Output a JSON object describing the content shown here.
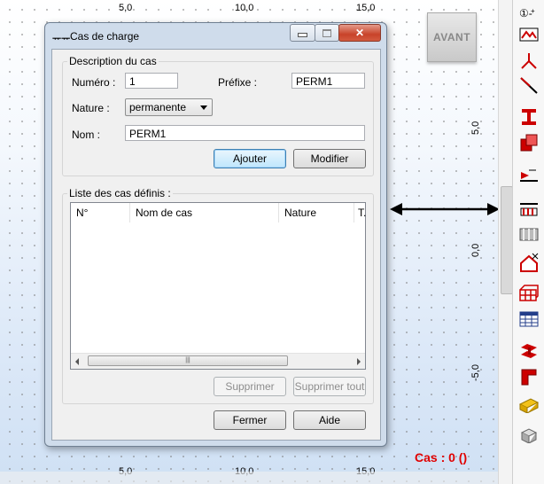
{
  "viewport": {
    "x_ticks": [
      "5,0",
      "10,0",
      "15,0"
    ],
    "y_ticks": [
      "5,0",
      "0,0",
      "-5,0"
    ],
    "view_cube_label": "AVANT",
    "status_case": "Cas : 0 ()",
    "status_color": "#e00000"
  },
  "dialog": {
    "title": "Cas de charge",
    "description_group": "Description du cas",
    "numero_label": "Numéro :",
    "numero_value": "1",
    "prefixe_label": "Préfixe :",
    "prefixe_value": "PERM1",
    "nature_label": "Nature :",
    "nature_value": "permanente",
    "nom_label": "Nom :",
    "nom_value": "PERM1",
    "ajouter": "Ajouter",
    "modifier": "Modifier",
    "list_group": "Liste des cas définis :",
    "columns": [
      "N°",
      "Nom de cas",
      "Nature",
      "T."
    ],
    "supprimer": "Supprimer",
    "supprimer_tout": "Supprimer tout",
    "fermer": "Fermer",
    "aide": "Aide"
  },
  "toolbar_icons": [
    "node-numbering-icon",
    "section-view-icon",
    "support-icon",
    "bar-icon",
    "i-beam-profile-icon",
    "material-icon",
    "release-icon",
    "load-cases-icon",
    "load-types-icon",
    "nodal-load-icon",
    "structure-model-icon",
    "table-icon",
    "steel-design-icon",
    "connection-icon",
    "wood-design-icon",
    "3d-view-icon"
  ]
}
